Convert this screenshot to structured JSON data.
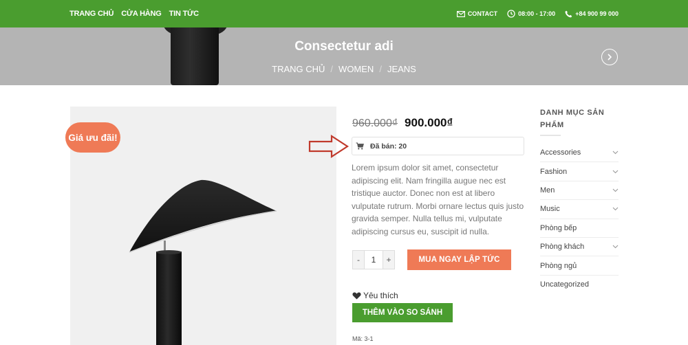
{
  "nav": {
    "items": [
      "TRANG CHỦ",
      "CỬA HÀNG",
      "TIN TỨC"
    ]
  },
  "contact": {
    "contact_label": "CONTACT",
    "hours": "08:00 - 17:00",
    "phone": "+84 900 99 000",
    "icons": [
      "envelope-icon",
      "clock-icon",
      "phone-icon"
    ]
  },
  "hero": {
    "title": "Consectetur adi",
    "breadcrumb": [
      "TRANG CHỦ",
      "WOMEN",
      "JEANS"
    ]
  },
  "product": {
    "sale_badge": "Giá ưu đãi!",
    "price_old": "960.000₫",
    "price_new": "900.000₫",
    "sold": "Đã bán: 20",
    "description": "Lorem ipsum dolor sit amet, consectetur adipiscing elit. Nam fringilla augue nec est tristique auctor. Donec non est at libero vulputate rutrum. Morbi ornare lectus quis justo gravida semper. Nulla tellus mi, vulputate adipiscing cursus eu, suscipit id nulla.",
    "qty_minus": "-",
    "qty_value": "1",
    "qty_plus": "+",
    "buy_label": "MUA NGAY LẬP TỨC",
    "wishlist_label": "Yêu thích",
    "compare_label": "THÊM VÀO SO SÁNH",
    "sku": "Mã: 3-1"
  },
  "sidebar": {
    "title": "DANH MỤC SẢN PHẨM",
    "categories": [
      {
        "label": "Accessories",
        "has_children": true
      },
      {
        "label": "Fashion",
        "has_children": true
      },
      {
        "label": "Men",
        "has_children": true
      },
      {
        "label": "Music",
        "has_children": true
      },
      {
        "label": "Phòng bếp",
        "has_children": false
      },
      {
        "label": "Phòng khách",
        "has_children": true
      },
      {
        "label": "Phòng ngủ",
        "has_children": false
      },
      {
        "label": "Uncategorized",
        "has_children": false
      }
    ]
  },
  "colors": {
    "brand_green": "#4a9d2f",
    "accent_orange": "#ef7a56",
    "annotation_red": "#c0392b"
  }
}
